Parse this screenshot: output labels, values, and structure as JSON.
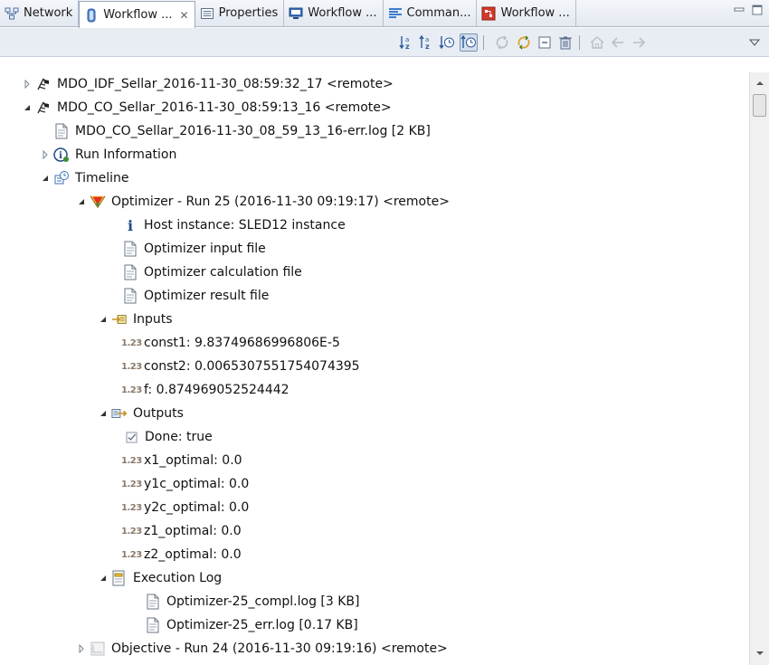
{
  "tabs": [
    {
      "label": "Network",
      "icon": "network-icon",
      "active": false
    },
    {
      "label": "Workflow ...",
      "icon": "data-store-icon",
      "active": true,
      "closable": true
    },
    {
      "label": "Properties",
      "icon": "properties-icon",
      "active": false
    },
    {
      "label": "Workflow ...",
      "icon": "monitor-icon",
      "active": false
    },
    {
      "label": "Comman...",
      "icon": "command-icon",
      "active": false
    },
    {
      "label": "Workflow ...",
      "icon": "workflow-red-icon",
      "active": false
    }
  ],
  "tree": {
    "rows": [
      {
        "label": "MDO_IDF_Sellar_2016-11-30_08:59:32_17 <remote>",
        "icon": "workflow-icon",
        "expander": "collapsed"
      },
      {
        "label": "MDO_CO_Sellar_2016-11-30_08:59:13_16 <remote>",
        "icon": "workflow-icon",
        "expander": "expanded"
      },
      {
        "label": "MDO_CO_Sellar_2016-11-30_08_59_13_16-err.log [2 KB]",
        "icon": "file-icon",
        "expander": "none"
      },
      {
        "label": "Run Information",
        "icon": "info-circle-icon",
        "expander": "collapsed"
      },
      {
        "label": "Timeline",
        "icon": "timeline-icon",
        "expander": "expanded"
      },
      {
        "label": "Optimizer - Run 25 (2016-11-30 09:19:17)  <remote>",
        "icon": "optimizer-icon",
        "expander": "expanded"
      },
      {
        "label": "Host instance: SLED12 instance",
        "icon": "info-icon",
        "expander": "none"
      },
      {
        "label": "Optimizer input file",
        "icon": "file-icon",
        "expander": "none"
      },
      {
        "label": "Optimizer calculation file",
        "icon": "file-icon",
        "expander": "none"
      },
      {
        "label": "Optimizer result file",
        "icon": "file-icon",
        "expander": "none"
      },
      {
        "label": "Inputs",
        "icon": "inputs-icon",
        "expander": "expanded"
      },
      {
        "label": "const1: 9.83749686996806E-5",
        "icon": "number-icon",
        "num": "1.23",
        "expander": "none"
      },
      {
        "label": "const2: 0.0065307551754074395",
        "icon": "number-icon",
        "num": "1.23",
        "expander": "none"
      },
      {
        "label": "f: 0.874969052524442",
        "icon": "number-icon",
        "num": "1.23",
        "expander": "none"
      },
      {
        "label": "Outputs",
        "icon": "outputs-icon",
        "expander": "expanded"
      },
      {
        "label": "Done: true",
        "icon": "checkbox-icon",
        "expander": "none"
      },
      {
        "label": "x1_optimal: 0.0",
        "icon": "number-icon",
        "num": "1.23",
        "expander": "none"
      },
      {
        "label": "y1c_optimal: 0.0",
        "icon": "number-icon",
        "num": "1.23",
        "expander": "none"
      },
      {
        "label": "y2c_optimal: 0.0",
        "icon": "number-icon",
        "num": "1.23",
        "expander": "none"
      },
      {
        "label": "z1_optimal: 0.0",
        "icon": "number-icon",
        "num": "1.23",
        "expander": "none"
      },
      {
        "label": "z2_optimal: 0.0",
        "icon": "number-icon",
        "num": "1.23",
        "expander": "none"
      },
      {
        "label": "Execution Log",
        "icon": "log-folder-icon",
        "expander": "expanded"
      },
      {
        "label": "Optimizer-25_compl.log [3 KB]",
        "icon": "file-icon",
        "expander": "none"
      },
      {
        "label": "Optimizer-25_err.log [0.17 KB]",
        "icon": "file-icon",
        "expander": "none"
      },
      {
        "label": "Objective - Run 24 (2016-11-30 09:19:16)  <remote>",
        "icon": "objective-icon",
        "expander": "collapsed"
      }
    ]
  }
}
